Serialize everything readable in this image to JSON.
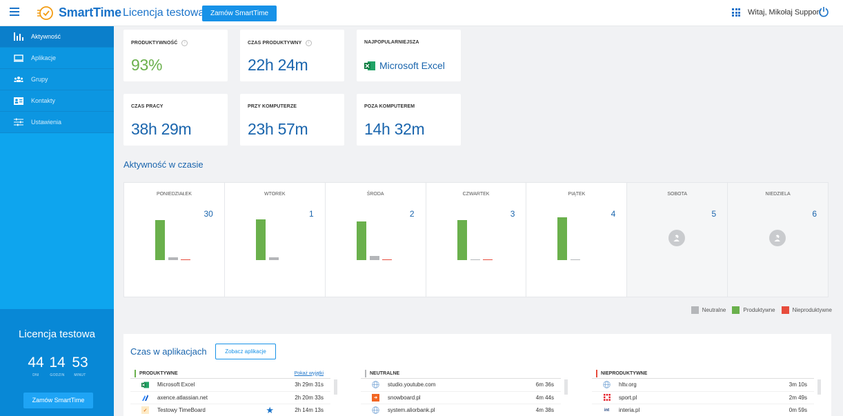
{
  "header": {
    "app_name": "SmartTime",
    "license_title": "Licencja testowa",
    "order_button": "Zamów SmartTime",
    "welcome": "Witaj, Mikołaj Support"
  },
  "sidebar": {
    "items": [
      {
        "label": "Aktywność",
        "icon": "bar-chart-icon",
        "active": true
      },
      {
        "label": "Aplikacje",
        "icon": "monitor-icon",
        "active": false
      },
      {
        "label": "Grupy",
        "icon": "group-icon",
        "active": false
      },
      {
        "label": "Kontakty",
        "icon": "contact-card-icon",
        "active": false
      },
      {
        "label": "Ustawienia",
        "icon": "sliders-icon",
        "active": false
      }
    ],
    "license": {
      "title": "Licencja testowa",
      "days": "44",
      "days_label": "DNI",
      "hours": "14",
      "hours_label": "GODZIN",
      "minutes": "53",
      "minutes_label": "MINUT",
      "order_button": "Zamów SmartTime"
    }
  },
  "stats": {
    "productivity": {
      "label": "PRODUKTYWNOŚĆ",
      "value": "93%"
    },
    "productive_time": {
      "label": "CZAS PRODUKTYWNY",
      "value": "22h 24m"
    },
    "most_popular": {
      "label": "NAJPOPULARNIEJSZA",
      "value": "Microsoft Excel"
    },
    "work_time": {
      "label": "CZAS PRACY",
      "value": "38h 29m"
    },
    "at_computer": {
      "label": "PRZY KOMPUTERZE",
      "value": "23h 57m"
    },
    "away": {
      "label": "POZA KOMPUTEREM",
      "value": "14h 32m"
    }
  },
  "activity": {
    "title": "Aktywność w czasie",
    "days": [
      {
        "name": "PONIEDZIAŁEK",
        "date": "30",
        "weekend": false,
        "productive": 0.72,
        "neutral": 0.05,
        "unproductive": 0.01
      },
      {
        "name": "WTOREK",
        "date": "1",
        "weekend": false,
        "productive": 0.74,
        "neutral": 0.05,
        "unproductive": 0
      },
      {
        "name": "ŚRODA",
        "date": "2",
        "weekend": false,
        "productive": 0.7,
        "neutral": 0.07,
        "unproductive": 0.01
      },
      {
        "name": "CZWARTEK",
        "date": "3",
        "weekend": false,
        "productive": 0.72,
        "neutral": 0.02,
        "unproductive": 0.02
      },
      {
        "name": "PIĄTEK",
        "date": "4",
        "weekend": false,
        "productive": 0.77,
        "neutral": 0.01,
        "unproductive": 0
      },
      {
        "name": "SOBOTA",
        "date": "5",
        "weekend": true
      },
      {
        "name": "NIEDZIELA",
        "date": "6",
        "weekend": true
      }
    ],
    "legend": {
      "neutral": "Neutralne",
      "productive": "Produktywne",
      "unproductive": "Nieproduktywne"
    },
    "colors": {
      "productive": "#6ab04c",
      "neutral": "#b4b6b9",
      "unproductive": "#e74c3c"
    }
  },
  "apps": {
    "title": "Czas w aplikacjach",
    "see_button": "Zobacz aplikacje",
    "productive": {
      "header": "PRODUKTYWNE",
      "link": "Pokaż wyjątki",
      "rows": [
        {
          "name": "Microsoft Excel",
          "time": "3h 29m 31s",
          "icon": "excel-icon"
        },
        {
          "name": "axence.atlassian.net",
          "time": "2h 20m 33s",
          "icon": "atlassian-icon"
        },
        {
          "name": "Testowy TimeBoard",
          "time": "2h 14m 13s",
          "icon": "timeboard-icon"
        }
      ]
    },
    "neutral": {
      "header": "NEUTRALNE",
      "rows": [
        {
          "name": "studio.youtube.com",
          "time": "6m 36s",
          "icon": "globe-icon"
        },
        {
          "name": "snowboard.pl",
          "time": "4m 44s",
          "icon": "snowboard-icon"
        },
        {
          "name": "system.aliorbank.pl",
          "time": "4m 38s",
          "icon": "globe-icon"
        }
      ]
    },
    "unproductive": {
      "header": "NIEPRODUKTYWNE",
      "rows": [
        {
          "name": "hltv.org",
          "time": "3m 10s",
          "icon": "globe-icon"
        },
        {
          "name": "sport.pl",
          "time": "2m 49s",
          "icon": "sport-icon"
        },
        {
          "name": "interia.pl",
          "time": "0m 59s",
          "icon": "interia-icon"
        }
      ]
    }
  }
}
